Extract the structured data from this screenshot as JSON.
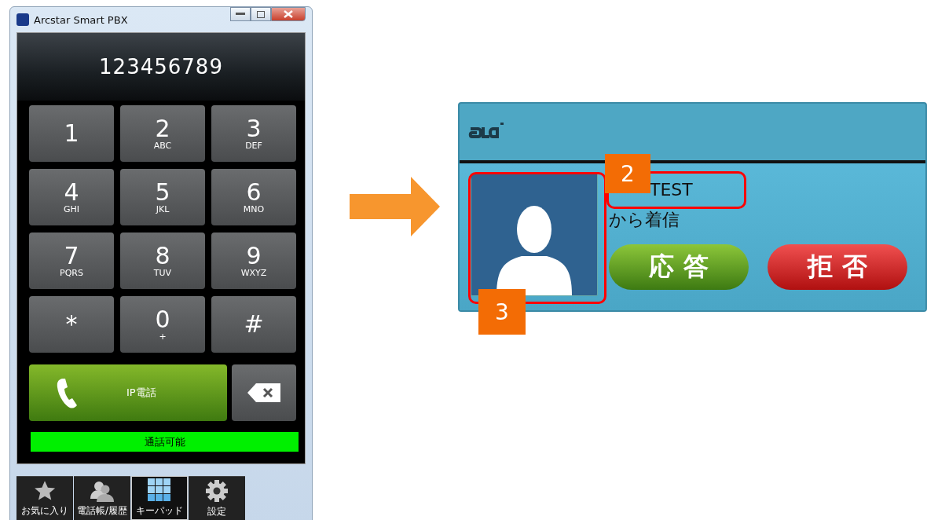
{
  "window": {
    "title": "Arcstar Smart PBX"
  },
  "display": {
    "number": "123456789"
  },
  "keys": [
    {
      "digit": "1"
    },
    {
      "digit": "2",
      "letters": "ABC"
    },
    {
      "digit": "3",
      "letters": "DEF"
    },
    {
      "digit": "4",
      "letters": "GHI"
    },
    {
      "digit": "5",
      "letters": "JKL"
    },
    {
      "digit": "6",
      "letters": "MNO"
    },
    {
      "digit": "7",
      "letters": "PQRS"
    },
    {
      "digit": "8",
      "letters": "TUV"
    },
    {
      "digit": "9",
      "letters": "WXYZ"
    },
    {
      "digit": "*"
    },
    {
      "digit": "0",
      "letters": "+"
    },
    {
      "digit": "#"
    }
  ],
  "call_button": {
    "label": "IP電話"
  },
  "status": {
    "text": "通話可能"
  },
  "tabs": [
    {
      "label": "お気に入り",
      "selected": false
    },
    {
      "label": "電話帳/履歴",
      "selected": false
    },
    {
      "label": "キーパッド",
      "selected": true
    },
    {
      "label": "設定",
      "selected": false
    }
  ],
  "popup": {
    "caller": "TEST",
    "message": "から着信",
    "answer": "応 答",
    "reject": "拒 否"
  },
  "callouts": [
    {
      "number": "2"
    },
    {
      "number": "3"
    }
  ]
}
